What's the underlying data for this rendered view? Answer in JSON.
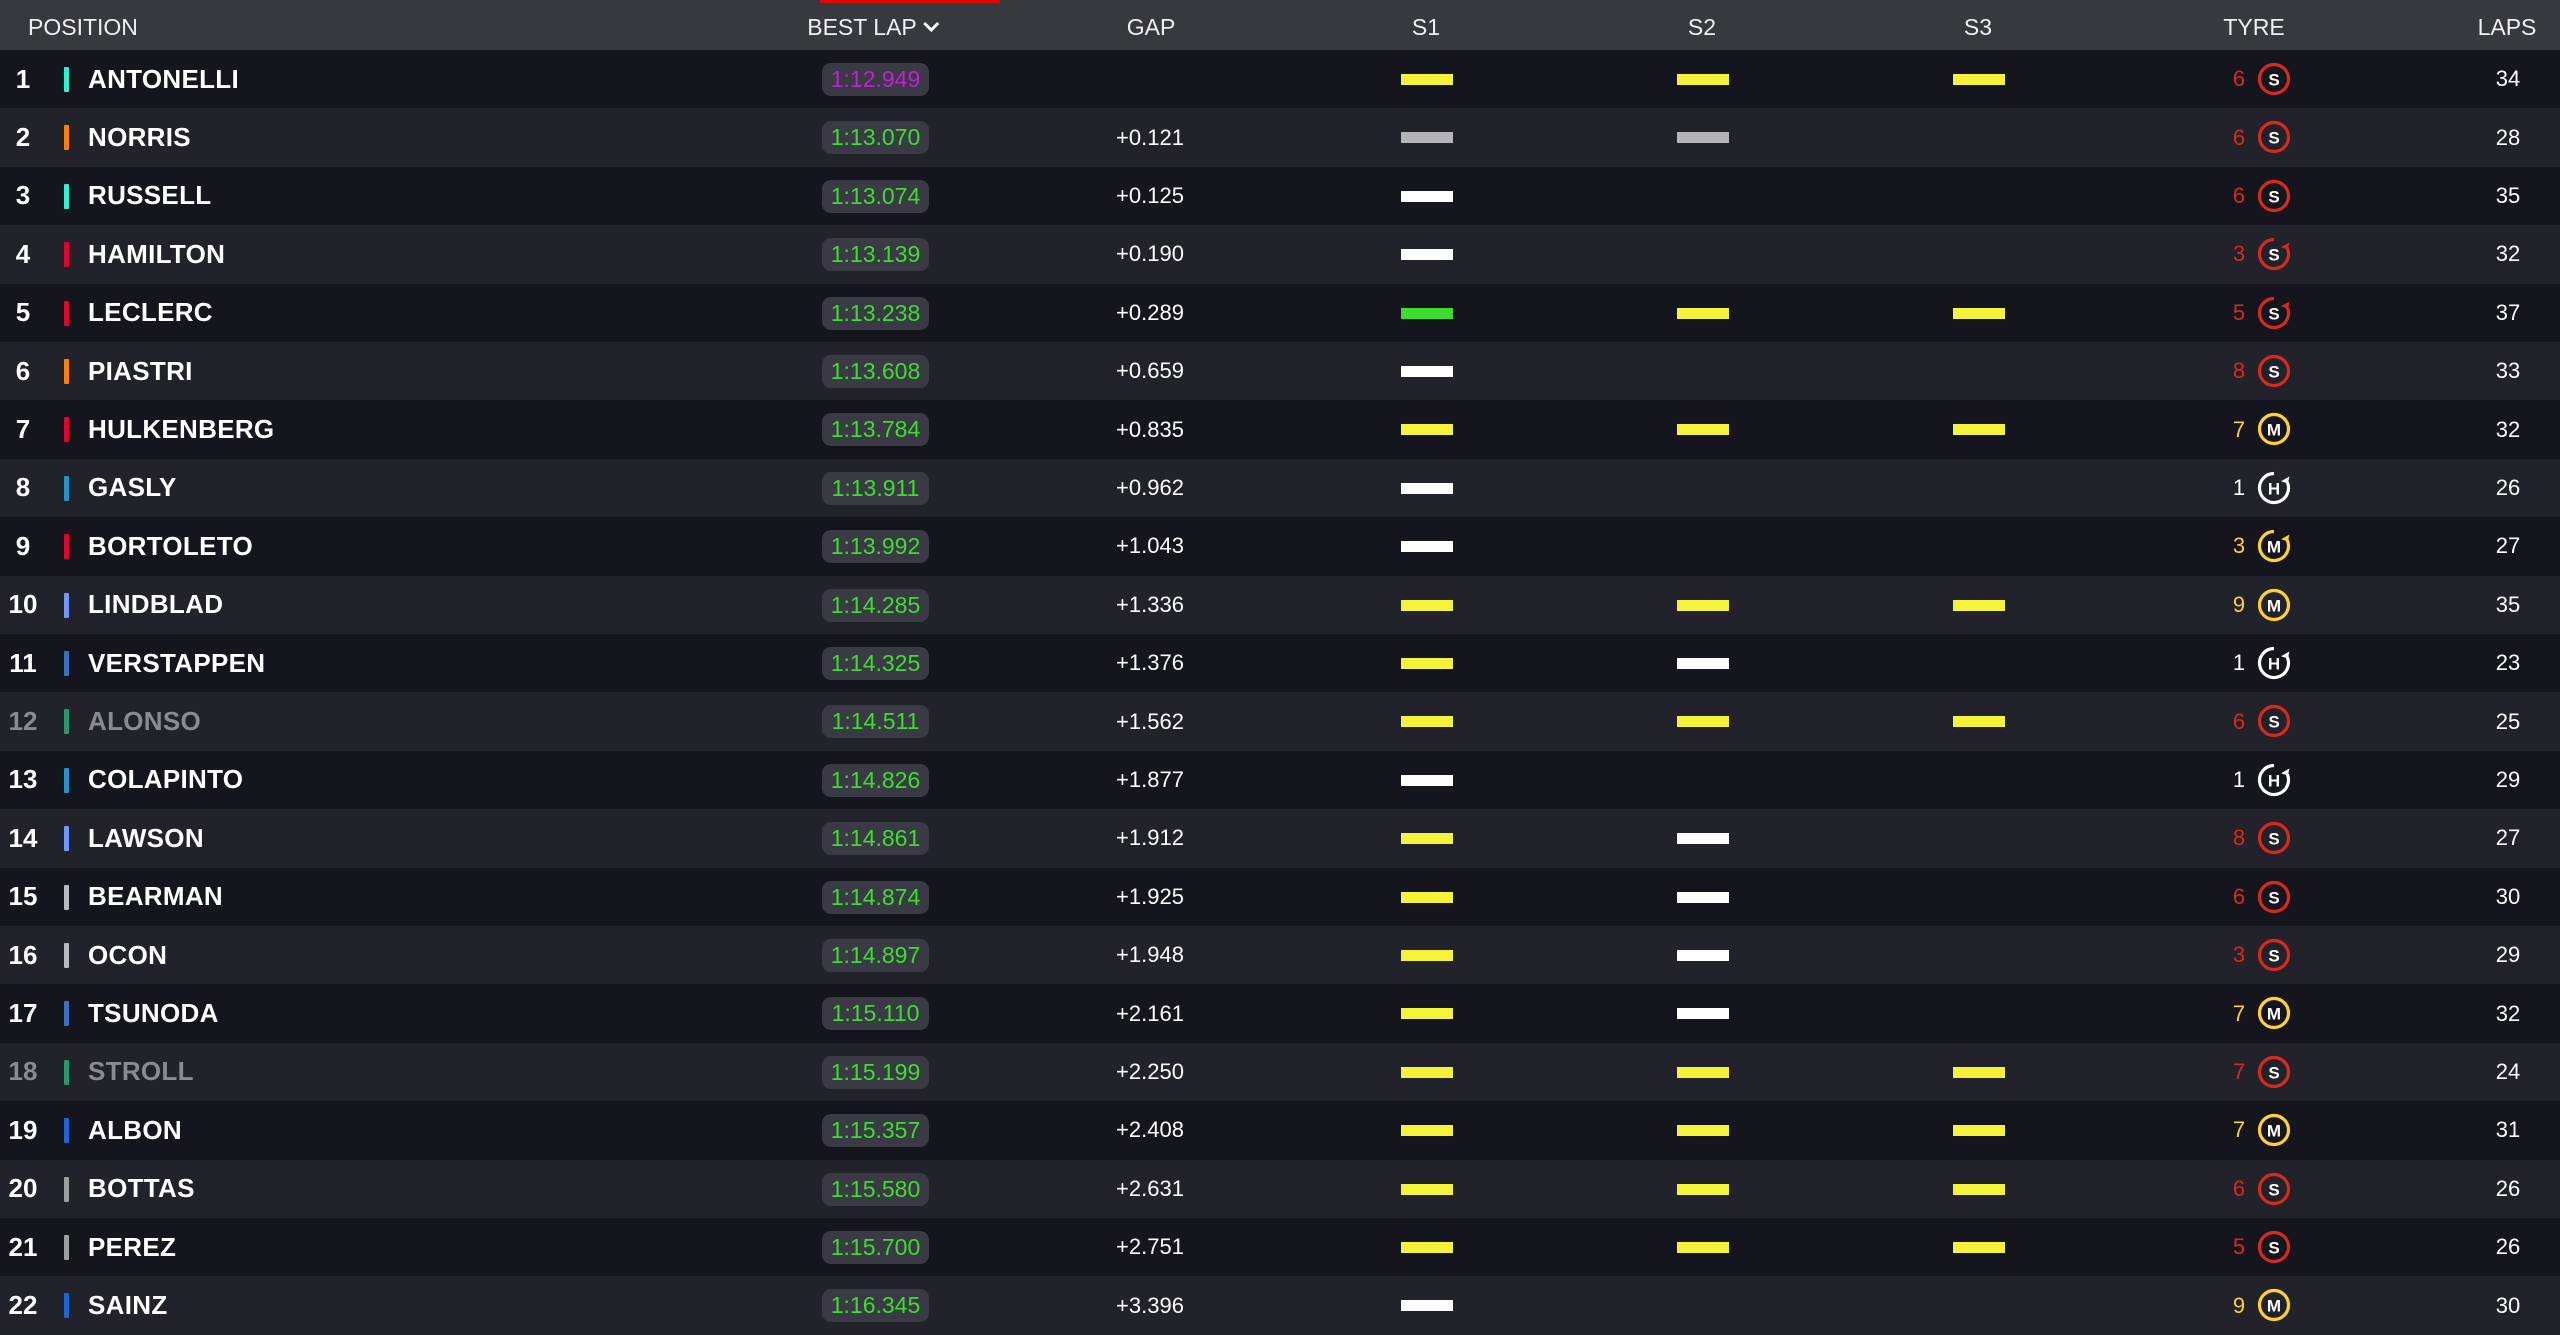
{
  "header": {
    "position": "POSITION",
    "best_lap": "BEST LAP",
    "gap": "GAP",
    "s1": "S1",
    "s2": "S2",
    "s3": "S3",
    "tyre": "TYRE",
    "laps": "LAPS",
    "sort_icon": "chevron-down-icon"
  },
  "colors": {
    "row_bg": "#15151e",
    "row_alt_bg": "#22222b",
    "header_bg": "#38383f",
    "lap_green": "#3cde2e",
    "lap_purple": "#c21fd6",
    "sector_yellow": "#f5f23a",
    "sector_green": "#3cde2e",
    "sector_white": "#ffffff",
    "sector_grey": "#b4b4b8",
    "tyre_soft": "#da291c",
    "tyre_medium": "#ffd12e",
    "tyre_hard": "#ffffff",
    "team_mercedes": "#27f4d2",
    "team_mclaren": "#ff8000",
    "team_ferrari": "#e8002d",
    "team_sauber": "#e8002d",
    "team_alpine": "#2293d1",
    "team_racing_bulls": "#6c98ff",
    "team_red_bull": "#3671c6",
    "team_aston_martin": "#229971",
    "team_haas": "#b6babd",
    "team_williams": "#1868db",
    "team_cadillac": "#9e9e9e"
  },
  "rows": [
    {
      "pos": "1",
      "driver": "ANTONELLI",
      "team_color": "#27f4d2",
      "best_lap": "1:12.949",
      "fastest": true,
      "gap": "",
      "s1": "yellow",
      "s2": "yellow",
      "s3": "yellow",
      "tyre_laps": "6",
      "tyre": "S",
      "tyre_state": "used",
      "laps": "34",
      "out": false
    },
    {
      "pos": "2",
      "driver": "NORRIS",
      "team_color": "#ff8000",
      "best_lap": "1:13.070",
      "fastest": false,
      "gap": "+0.121",
      "s1": "grey",
      "s2": "grey",
      "s3": "",
      "tyre_laps": "6",
      "tyre": "S",
      "tyre_state": "used",
      "laps": "28",
      "out": false
    },
    {
      "pos": "3",
      "driver": "RUSSELL",
      "team_color": "#27f4d2",
      "best_lap": "1:13.074",
      "fastest": false,
      "gap": "+0.125",
      "s1": "white",
      "s2": "",
      "s3": "",
      "tyre_laps": "6",
      "tyre": "S",
      "tyre_state": "used",
      "laps": "35",
      "out": false
    },
    {
      "pos": "4",
      "driver": "HAMILTON",
      "team_color": "#e8002d",
      "best_lap": "1:13.139",
      "fastest": false,
      "gap": "+0.190",
      "s1": "white",
      "s2": "",
      "s3": "",
      "tyre_laps": "3",
      "tyre": "S",
      "tyre_state": "cycle",
      "laps": "32",
      "out": false
    },
    {
      "pos": "5",
      "driver": "LECLERC",
      "team_color": "#e8002d",
      "best_lap": "1:13.238",
      "fastest": false,
      "gap": "+0.289",
      "s1": "green",
      "s2": "yellow",
      "s3": "yellow",
      "tyre_laps": "5",
      "tyre": "S",
      "tyre_state": "cycle",
      "laps": "37",
      "out": false
    },
    {
      "pos": "6",
      "driver": "PIASTRI",
      "team_color": "#ff8000",
      "best_lap": "1:13.608",
      "fastest": false,
      "gap": "+0.659",
      "s1": "white",
      "s2": "",
      "s3": "",
      "tyre_laps": "8",
      "tyre": "S",
      "tyre_state": "used",
      "laps": "33",
      "out": false
    },
    {
      "pos": "7",
      "driver": "HULKENBERG",
      "team_color": "#e8002d",
      "best_lap": "1:13.784",
      "fastest": false,
      "gap": "+0.835",
      "s1": "yellow",
      "s2": "yellow",
      "s3": "yellow",
      "tyre_laps": "7",
      "tyre": "M",
      "tyre_state": "used",
      "laps": "32",
      "out": false
    },
    {
      "pos": "8",
      "driver": "GASLY",
      "team_color": "#2293d1",
      "best_lap": "1:13.911",
      "fastest": false,
      "gap": "+0.962",
      "s1": "white",
      "s2": "",
      "s3": "",
      "tyre_laps": "1",
      "tyre": "H",
      "tyre_state": "cycle",
      "laps": "26",
      "out": false
    },
    {
      "pos": "9",
      "driver": "BORTOLETO",
      "team_color": "#e8002d",
      "best_lap": "1:13.992",
      "fastest": false,
      "gap": "+1.043",
      "s1": "white",
      "s2": "",
      "s3": "",
      "tyre_laps": "3",
      "tyre": "M",
      "tyre_state": "cycle",
      "laps": "27",
      "out": false
    },
    {
      "pos": "10",
      "driver": "LINDBLAD",
      "team_color": "#6c98ff",
      "best_lap": "1:14.285",
      "fastest": false,
      "gap": "+1.336",
      "s1": "yellow",
      "s2": "yellow",
      "s3": "yellow",
      "tyre_laps": "9",
      "tyre": "M",
      "tyre_state": "used",
      "laps": "35",
      "out": false
    },
    {
      "pos": "11",
      "driver": "VERSTAPPEN",
      "team_color": "#3671c6",
      "best_lap": "1:14.325",
      "fastest": false,
      "gap": "+1.376",
      "s1": "yellow",
      "s2": "white",
      "s3": "",
      "tyre_laps": "1",
      "tyre": "H",
      "tyre_state": "cycle",
      "laps": "23",
      "out": false
    },
    {
      "pos": "12",
      "driver": "ALONSO",
      "team_color": "#229971",
      "best_lap": "1:14.511",
      "fastest": false,
      "gap": "+1.562",
      "s1": "yellow",
      "s2": "yellow",
      "s3": "yellow",
      "tyre_laps": "6",
      "tyre": "S",
      "tyre_state": "used",
      "laps": "25",
      "out": true
    },
    {
      "pos": "13",
      "driver": "COLAPINTO",
      "team_color": "#2293d1",
      "best_lap": "1:14.826",
      "fastest": false,
      "gap": "+1.877",
      "s1": "white",
      "s2": "",
      "s3": "",
      "tyre_laps": "1",
      "tyre": "H",
      "tyre_state": "cycle",
      "laps": "29",
      "out": false
    },
    {
      "pos": "14",
      "driver": "LAWSON",
      "team_color": "#6c98ff",
      "best_lap": "1:14.861",
      "fastest": false,
      "gap": "+1.912",
      "s1": "yellow",
      "s2": "white",
      "s3": "",
      "tyre_laps": "8",
      "tyre": "S",
      "tyre_state": "used",
      "laps": "27",
      "out": false
    },
    {
      "pos": "15",
      "driver": "BEARMAN",
      "team_color": "#b6babd",
      "best_lap": "1:14.874",
      "fastest": false,
      "gap": "+1.925",
      "s1": "yellow",
      "s2": "white",
      "s3": "",
      "tyre_laps": "6",
      "tyre": "S",
      "tyre_state": "used",
      "laps": "30",
      "out": false
    },
    {
      "pos": "16",
      "driver": "OCON",
      "team_color": "#b6babd",
      "best_lap": "1:14.897",
      "fastest": false,
      "gap": "+1.948",
      "s1": "yellow",
      "s2": "white",
      "s3": "",
      "tyre_laps": "3",
      "tyre": "S",
      "tyre_state": "used",
      "laps": "29",
      "out": false
    },
    {
      "pos": "17",
      "driver": "TSUNODA",
      "team_color": "#3671c6",
      "best_lap": "1:15.110",
      "fastest": false,
      "gap": "+2.161",
      "s1": "yellow",
      "s2": "white",
      "s3": "",
      "tyre_laps": "7",
      "tyre": "M",
      "tyre_state": "used",
      "laps": "32",
      "out": false
    },
    {
      "pos": "18",
      "driver": "STROLL",
      "team_color": "#229971",
      "best_lap": "1:15.199",
      "fastest": false,
      "gap": "+2.250",
      "s1": "yellow",
      "s2": "yellow",
      "s3": "yellow",
      "tyre_laps": "7",
      "tyre": "S",
      "tyre_state": "used",
      "laps": "24",
      "out": true
    },
    {
      "pos": "19",
      "driver": "ALBON",
      "team_color": "#1868db",
      "best_lap": "1:15.357",
      "fastest": false,
      "gap": "+2.408",
      "s1": "yellow",
      "s2": "yellow",
      "s3": "yellow",
      "tyre_laps": "7",
      "tyre": "M",
      "tyre_state": "used",
      "laps": "31",
      "out": false
    },
    {
      "pos": "20",
      "driver": "BOTTAS",
      "team_color": "#9e9e9e",
      "best_lap": "1:15.580",
      "fastest": false,
      "gap": "+2.631",
      "s1": "yellow",
      "s2": "yellow",
      "s3": "yellow",
      "tyre_laps": "6",
      "tyre": "S",
      "tyre_state": "used",
      "laps": "26",
      "out": false
    },
    {
      "pos": "21",
      "driver": "PEREZ",
      "team_color": "#9e9e9e",
      "best_lap": "1:15.700",
      "fastest": false,
      "gap": "+2.751",
      "s1": "yellow",
      "s2": "yellow",
      "s3": "yellow",
      "tyre_laps": "5",
      "tyre": "S",
      "tyre_state": "used",
      "laps": "26",
      "out": false
    },
    {
      "pos": "22",
      "driver": "SAINZ",
      "team_color": "#1868db",
      "best_lap": "1:16.345",
      "fastest": false,
      "gap": "+3.396",
      "s1": "white",
      "s2": "",
      "s3": "",
      "tyre_laps": "9",
      "tyre": "M",
      "tyre_state": "used",
      "laps": "30",
      "out": false
    }
  ]
}
